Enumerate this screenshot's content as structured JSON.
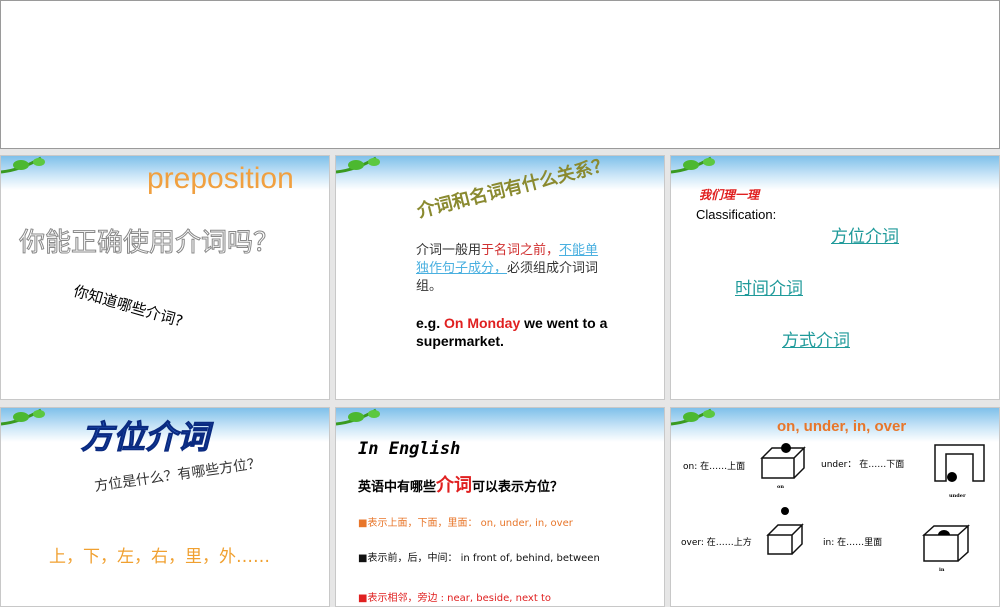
{
  "slides": [
    {
      "title": "preposition",
      "question": "你能正确使用介词吗？",
      "sub": "你知道哪些介词?"
    },
    {
      "title": "介词和名词有什么关系？",
      "p1": "介词一般用",
      "p1_red": "于名词之前，",
      "p1_link": "不能单独作句子成分，",
      "p1_rest": "必须组成介词词组。",
      "eg": "e.g. ",
      "eg_red": "On Monday",
      "eg_rest": " we went to a supermarket."
    },
    {
      "heading": "我们理一理",
      "label": "Classification:",
      "links": [
        "方位介词",
        "时间介词",
        "方式介词"
      ]
    },
    {
      "title": "方位介词",
      "question": "方位是什么？有哪些方位？",
      "list": "上，下，左，右，里，外……"
    },
    {
      "title": "In English",
      "question_a": "英语中有哪些",
      "question_red": "介词",
      "question_b": "可以表示方位？",
      "bullets": [
        "■表示上面，下面，里面： on, under, in, over",
        "■表示前，后，中间： in front of, behind, between",
        "■表示相邻，旁边 : near, beside, next to"
      ]
    },
    {
      "title": "on, under, in, over",
      "items": [
        "on: 在……上面",
        "under： 在……下面",
        "over: 在……上方",
        "in: 在……里面"
      ],
      "captions": [
        "on",
        "under",
        "in"
      ]
    }
  ],
  "colors": {
    "orange": "#e8762a",
    "red": "#e02020",
    "teal": "#1f9a9a"
  }
}
